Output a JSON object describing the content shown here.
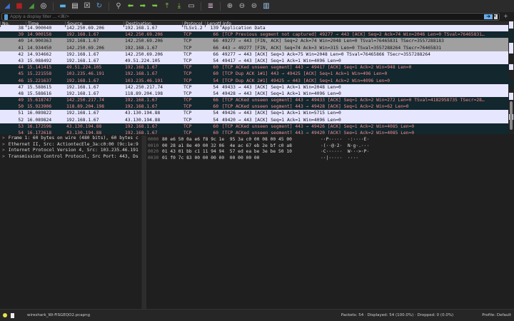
{
  "toolbar": {
    "icons": [
      "shark-fin-start-icon",
      "stop-icon",
      "restart-icon",
      "options-icon",
      "open-folder-icon",
      "file-icon",
      "close-file-icon",
      "reload-icon",
      "find-icon",
      "go-back-icon",
      "go-forward-icon",
      "go-to-packet-icon",
      "first-packet-icon",
      "last-packet-icon",
      "autoscroll-icon",
      "colorize-icon",
      "zoom-in-icon",
      "zoom-out-icon",
      "normal-size-icon",
      "resize-columns-icon"
    ]
  },
  "filter": {
    "placeholder": "Apply a display filter ... <⌘/>",
    "plus": "+"
  },
  "columns": [
    "No.",
    "Time",
    "Source",
    "Destination",
    "Protocol",
    "Length",
    "Info"
  ],
  "packets": [
    {
      "no": "38",
      "time": "14.900040",
      "src": "142.250.69.206",
      "dst": "192.168.1.67",
      "proto": "TLSv1.2",
      "len": "139",
      "info": "Application Data",
      "style": "w"
    },
    {
      "no": "39",
      "time": "14.900158",
      "src": "192.168.1.67",
      "dst": "142.250.69.206",
      "proto": "TCP",
      "len": "66",
      "info": "[TCP Previous segment not captured] 49277 → 443 [ACK] Seq=2 Ack=74 Win=2046 Len=0 TSval=76465831…",
      "style": "d"
    },
    {
      "no": "40",
      "time": "14.900363",
      "src": "192.168.1.67",
      "dst": "142.250.69.206",
      "proto": "TCP",
      "len": "66",
      "info": "49277 → 443 [FIN, ACK] Seq=2 Ack=74 Win=2048 Len=0 TSval=76465831 TSecr=3557288183",
      "style": "g"
    },
    {
      "no": "41",
      "time": "14.934450",
      "src": "142.250.69.206",
      "dst": "192.168.1.67",
      "proto": "TCP",
      "len": "66",
      "info": "443 → 49277 [FIN, ACK] Seq=74 Ack=3 Win=315 Len=0 TSval=3557288264 TSecr=76465831",
      "style": "g"
    },
    {
      "no": "42",
      "time": "14.934662",
      "src": "192.168.1.67",
      "dst": "142.250.69.206",
      "proto": "TCP",
      "len": "66",
      "info": "49277 → 443 [ACK] Seq=3 Ack=75 Win=2048 Len=0 TSval=76465866 TSecr=3557288264",
      "style": "w"
    },
    {
      "no": "43",
      "time": "15.088492",
      "src": "192.168.1.67",
      "dst": "49.51.224.105",
      "proto": "TCP",
      "len": "54",
      "info": "49417 → 443 [ACK] Seq=1 Ack=1 Win=4096 Len=0",
      "style": "w"
    },
    {
      "no": "44",
      "time": "15.141415",
      "src": "49.51.224.105",
      "dst": "192.168.1.67",
      "proto": "TCP",
      "len": "60",
      "info": "[TCP ACKed unseen segment] 443 → 49417 [ACK] Seq=1 Ack=2 Win=948 Len=0",
      "style": "d"
    },
    {
      "no": "45",
      "time": "15.221558",
      "src": "103.235.46.191",
      "dst": "192.168.1.67",
      "proto": "TCP",
      "len": "60",
      "info": "[TCP Dup ACK 1#1] 443 → 49425 [ACK] Seq=1 Ack=1 Win=496 Len=0",
      "style": "d"
    },
    {
      "no": "46",
      "time": "15.221637",
      "src": "192.168.1.67",
      "dst": "103.235.46.191",
      "proto": "TCP",
      "len": "54",
      "info": "[TCP Dup ACK 2#1] 49425 → 443 [ACK] Seq=1 Ack=2 Win=4096 Len=0",
      "style": "d"
    },
    {
      "no": "47",
      "time": "15.588615",
      "src": "192.168.1.67",
      "dst": "142.250.217.74",
      "proto": "TCP",
      "len": "54",
      "info": "49433 → 443 [ACK] Seq=1 Ack=1 Win=2048 Len=0",
      "style": "w"
    },
    {
      "no": "48",
      "time": "15.588616",
      "src": "192.168.1.67",
      "dst": "118.89.204.198",
      "proto": "TCP",
      "len": "54",
      "info": "49428 → 443 [ACK] Seq=1 Ack=1 Win=4096 Len=0",
      "style": "w"
    },
    {
      "no": "49",
      "time": "15.618747",
      "src": "142.250.217.74",
      "dst": "192.168.1.67",
      "proto": "TCP",
      "len": "66",
      "info": "[TCP ACKed unseen segment] 443 → 49433 [ACK] Seq=1 Ack=2 Win=272 Len=0 TSval=4182958735 TSecr=28…",
      "style": "d"
    },
    {
      "no": "50",
      "time": "15.923906",
      "src": "118.89.204.198",
      "dst": "192.168.1.67",
      "proto": "TCP",
      "len": "60",
      "info": "[TCP ACKed unseen segment] 443 → 49428 [ACK] Seq=1 Ack=2 Win=62 Len=0",
      "style": "d"
    },
    {
      "no": "51",
      "time": "16.089822",
      "src": "192.168.1.67",
      "dst": "43.130.194.88",
      "proto": "TCP",
      "len": "54",
      "info": "49426 → 443 [ACK] Seq=1 Ack=1 Win=5715 Len=0",
      "style": "w"
    },
    {
      "no": "52",
      "time": "16.089824",
      "src": "192.168.1.67",
      "dst": "43.130.194.88",
      "proto": "TCP",
      "len": "54",
      "info": "49420 → 443 [ACK] Seq=1 Ack=1 Win=4096 Len=0",
      "style": "w"
    },
    {
      "no": "53",
      "time": "16.172596",
      "src": "43.130.194.88",
      "dst": "192.168.1.67",
      "proto": "TCP",
      "len": "60",
      "info": "[TCP ACKed unseen segment] 443 → 49426 [ACK] Seq=1 Ack=2 Win=4085 Len=0",
      "style": "d"
    },
    {
      "no": "54",
      "time": "16.172618",
      "src": "43.130.194.88",
      "dst": "192.168.1.67",
      "proto": "TCP",
      "len": "60",
      "info": "[TCP ACKed unseen segment] 443 → 49420 [ACK] Seq=1 Ack=2 Win=4085 Len=0",
      "style": "d"
    }
  ],
  "details": [
    {
      "arrow": ">",
      "text": "Frame 1: 60 bytes on wire (480 bits), 60 bytes c"
    },
    {
      "arrow": ">",
      "text": "Ethernet II, Src: ActiontecEle_3a:c0:00 (9c:1e:9"
    },
    {
      "arrow": ">",
      "text": "Internet Protocol Version 4, Src: 103.235.46.191"
    },
    {
      "arrow": ">",
      "text": "Transmission Control Protocol, Src Port: 443, Ds"
    }
  ],
  "hex": [
    {
      "off": "0000",
      "bytes": "80 e6 50 0a e6 f8 9c 1e  95 3a c0 00 08 00 45 00",
      "ascii": "··P·····  ·:····E·"
    },
    {
      "off": "0010",
      "bytes": "00 28 a1 8e 40 00 32 06  4e ac 67 eb 2e bf c0 a8",
      "ascii": "·(··@·2·  N·g·.···"
    },
    {
      "off": "0020",
      "bytes": "01 43 01 bb c1 11 94 94  57 ed ea be 3e be 50 10",
      "ascii": "·C······  W···>·P·"
    },
    {
      "off": "0030",
      "bytes": "01 f0 7c 83 00 00 00 00  00 00 00 00",
      "ascii": "··|·····  ····"
    }
  ],
  "status": {
    "file": "wireshark_Wi-FiSGEQO2.pcapng",
    "packets": "Packets: 54 · Displayed: 54 (100.0%) · Dropped: 0 (0.0%)",
    "profile": "Profile: Default"
  }
}
